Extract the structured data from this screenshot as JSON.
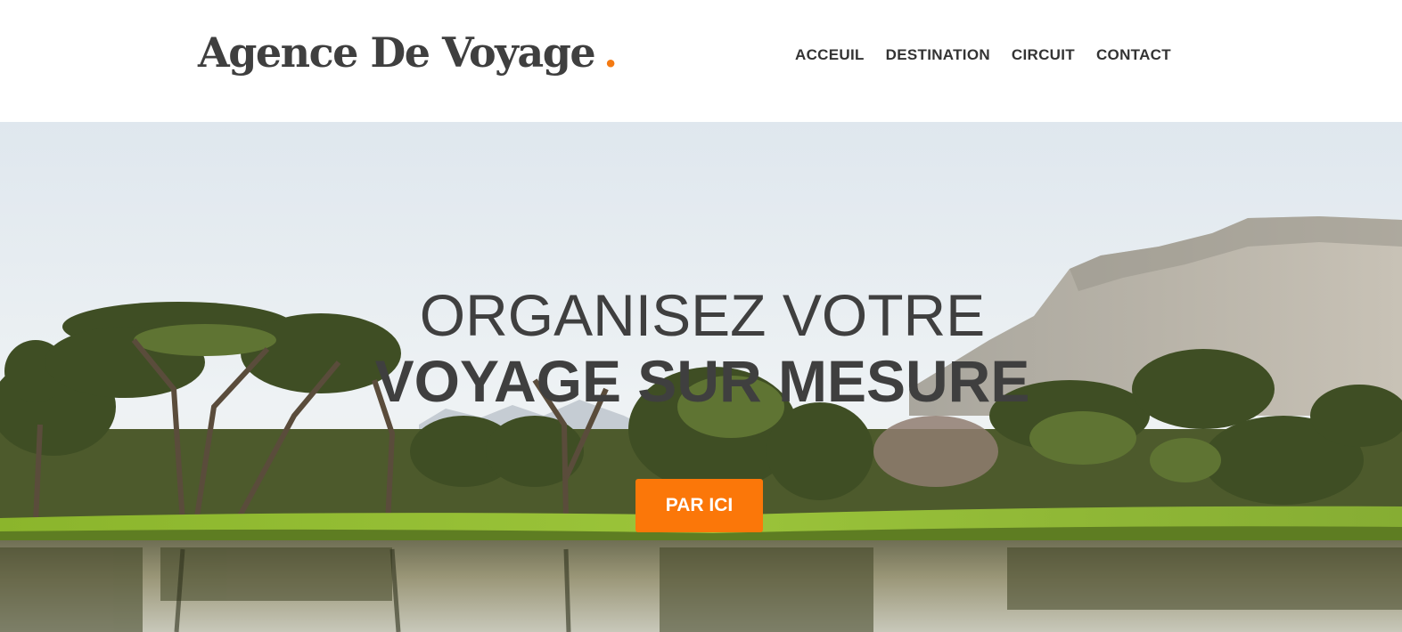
{
  "header": {
    "logo_text": "Agence De Voyage",
    "logo_dot": ".",
    "nav": [
      {
        "label": "ACCEUIL"
      },
      {
        "label": "DESTINATION"
      },
      {
        "label": "CIRCUIT"
      },
      {
        "label": "CONTACT"
      }
    ]
  },
  "hero": {
    "title_line1": "ORGANISEZ VOTRE",
    "title_line2": "VOYAGE SUR MESURE",
    "cta_label": "PAR ICI"
  },
  "colors": {
    "accent": "#fb7709",
    "text_dark": "#3f3f3f"
  }
}
